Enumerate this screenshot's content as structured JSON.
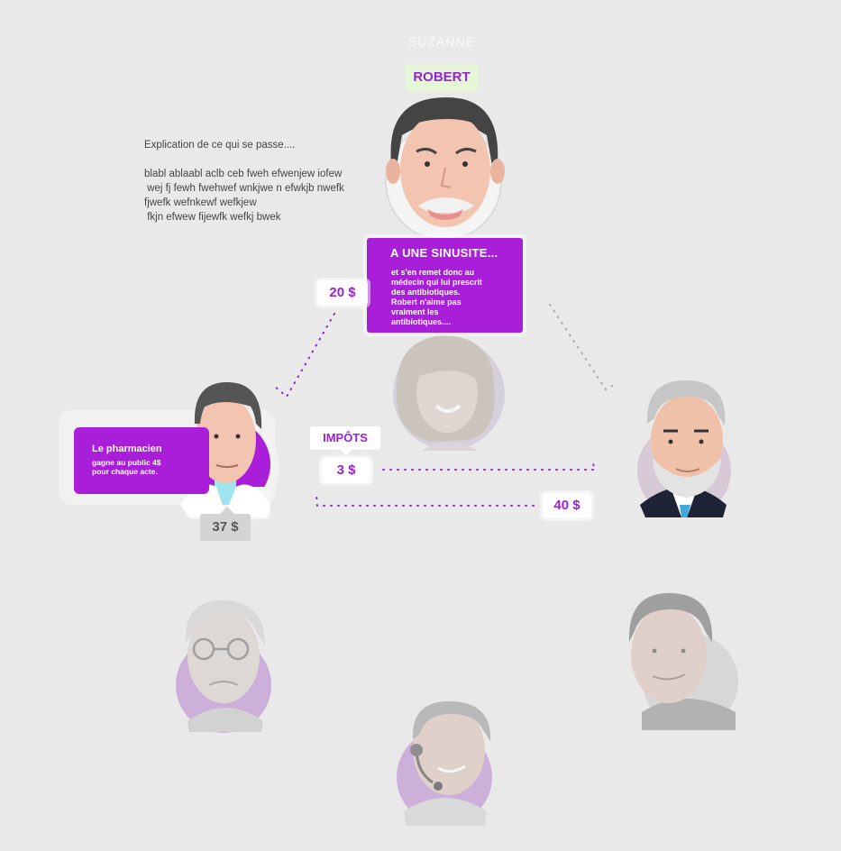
{
  "top_name": "SUZANNE",
  "robert_tag": "ROBERT",
  "explanation": {
    "title": "Explication de ce qui se passe....",
    "lines": [
      "blabl ablaabl aclb ceb fweh efwenjew iofew",
      " wej fj fewh fwehwef wnkjwe n efwkjb nwefk",
      "fjwefk wefnkewf wefkjew",
      " fkjn efwew fijewfk wefkj bwek"
    ]
  },
  "sinusite_card": {
    "title": "A UNE SINUSITE...",
    "body_lines": [
      "et s'en remet donc au",
      "médecin qui lui prescrit",
      "des antibiotiques.",
      "Robert n'aime pas",
      "vraiment les",
      "antibiotiques...."
    ]
  },
  "pharmacist_card": {
    "title": "Le pharmacien",
    "body_lines": [
      "gagne au public 4$",
      "pour chaque acte."
    ]
  },
  "labels": {
    "price_20": "20 $",
    "impots": "IMPÔTS",
    "price_3": "3 $",
    "price_40": "40 $",
    "price_37": "37 $"
  },
  "colors": {
    "accent": "#a91fd9",
    "accent_text": "#9b21d3",
    "background": "#e9e9e9",
    "tag_bg": "#e6f7d9"
  }
}
